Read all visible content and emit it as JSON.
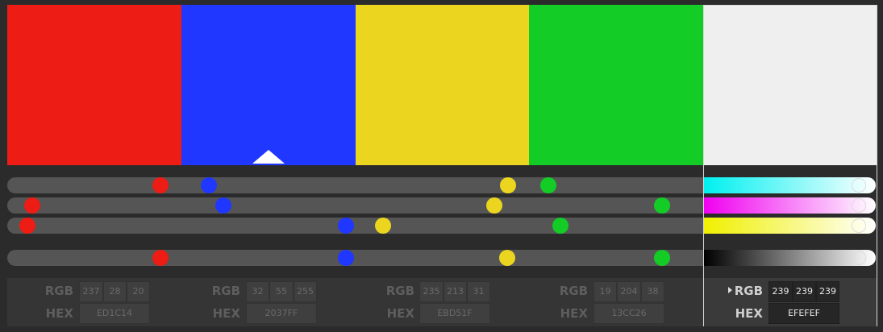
{
  "swatches": [
    {
      "id": "red",
      "color": "#ED1C14",
      "rgb": [
        "237",
        "28",
        "20"
      ],
      "hex": "ED1C14"
    },
    {
      "id": "blue",
      "color": "#2037FF",
      "rgb": [
        "32",
        "55",
        "255"
      ],
      "hex": "2037FF"
    },
    {
      "id": "yellow",
      "color": "#EBD51F",
      "rgb": [
        "235",
        "213",
        "31"
      ],
      "hex": "EBD51F"
    },
    {
      "id": "green",
      "color": "#13CC26",
      "rgb": [
        "19",
        "204",
        "38"
      ],
      "hex": "13CC26"
    },
    {
      "id": "white",
      "color": "#EFEFEF",
      "rgb": [
        "239",
        "239",
        "239"
      ],
      "hex": "EFEFEF"
    }
  ],
  "selected_swatch": "white",
  "labels": {
    "rgb": "RGB",
    "hex": "HEX"
  },
  "sliders": [
    {
      "channel": "cyan",
      "tail_gradient": [
        "#00F0F0",
        "#FFFFFF"
      ]
    },
    {
      "channel": "magenta",
      "tail_gradient": [
        "#F000F0",
        "#FFFFFF"
      ]
    },
    {
      "channel": "yellow",
      "tail_gradient": [
        "#F0F000",
        "#FFFFFF"
      ]
    },
    {
      "channel": "key",
      "tail_gradient": [
        "#000000",
        "#FFFFFF"
      ]
    }
  ],
  "colors": {
    "background": "#2b2b2b",
    "track": "#555555",
    "panel": "#353535"
  }
}
